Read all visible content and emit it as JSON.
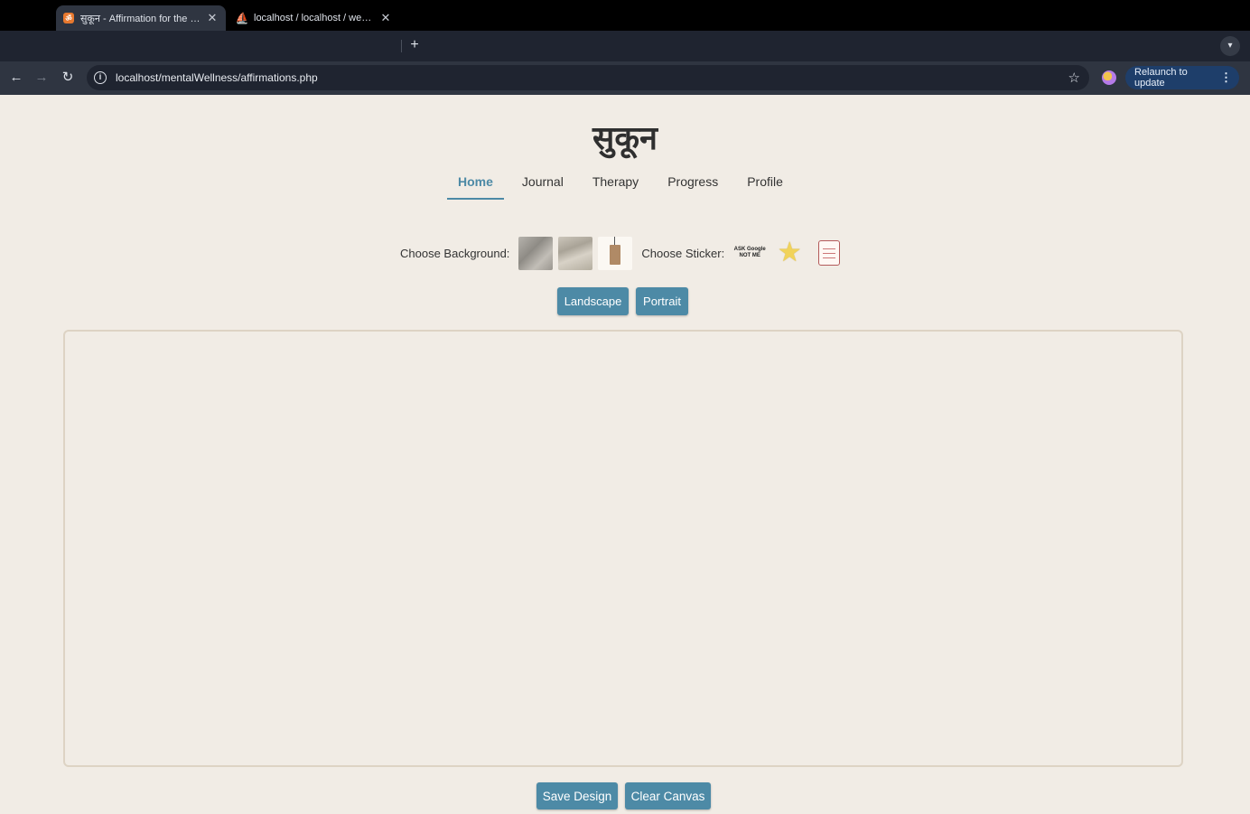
{
  "browser": {
    "tabs": [
      {
        "title": "सुकून - Affirmation for the Day",
        "active": true,
        "favicon": "orange-app-icon"
      },
      {
        "title": "localhost / localhost / webApp",
        "active": false,
        "favicon": "phpmyadmin-icon"
      }
    ],
    "new_tab_label": "+",
    "url": "localhost/mentalWellness/affirmations.php",
    "relaunch_label": "Relaunch to update"
  },
  "site": {
    "brand": "सुकून",
    "nav": [
      {
        "label": "Home",
        "active": true
      },
      {
        "label": "Journal",
        "active": false
      },
      {
        "label": "Therapy",
        "active": false
      },
      {
        "label": "Progress",
        "active": false
      },
      {
        "label": "Profile",
        "active": false
      }
    ]
  },
  "editor": {
    "background_label": "Choose Background:",
    "sticker_label": "Choose Sticker:",
    "sticker_google_text": "ASK Google NOT ME",
    "landscape_label": "Landscape",
    "portrait_label": "Portrait",
    "save_label": "Save Design",
    "clear_label": "Clear Canvas"
  },
  "colors": {
    "accent": "#4d8aa6",
    "page_bg": "#f1ece5",
    "relaunch_bg": "#1e3e6a"
  }
}
